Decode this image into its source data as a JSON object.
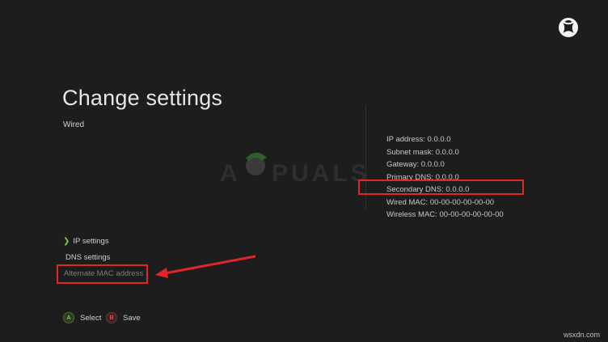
{
  "header": {
    "title": "Change settings",
    "subtitle": "Wired"
  },
  "network_info": {
    "ip_address": "IP address: 0.0.0.0",
    "subnet_mask": "Subnet mask: 0.0.0.0",
    "gateway": "Gateway: 0.0.0.0",
    "primary_dns": "Primary DNS: 0.0.0.0",
    "secondary_dns": "Secondary DNS: 0.0.0.0",
    "wired_mac": "Wired MAC: 00-00-00-00-00-00",
    "wireless_mac": "Wireless MAC: 00-00-00-00-00-00"
  },
  "menu": {
    "ip_settings": "IP settings",
    "dns_settings": "DNS settings",
    "alternate_mac": "Alternate MAC address"
  },
  "buttons": {
    "a_glyph": "A",
    "select_label": "Select",
    "b_glyph": "B",
    "save_label": "Save"
  },
  "watermark": {
    "brand": "APPUALS",
    "site": "wsxdn.com"
  },
  "colors": {
    "background": "#1d1d1d",
    "highlight": "#e0262a",
    "accent_green": "#7dcf3a"
  },
  "icons": {
    "logo": "xbox-logo-icon",
    "chevron": "chevron-right-icon",
    "annotation": "red-arrow"
  }
}
